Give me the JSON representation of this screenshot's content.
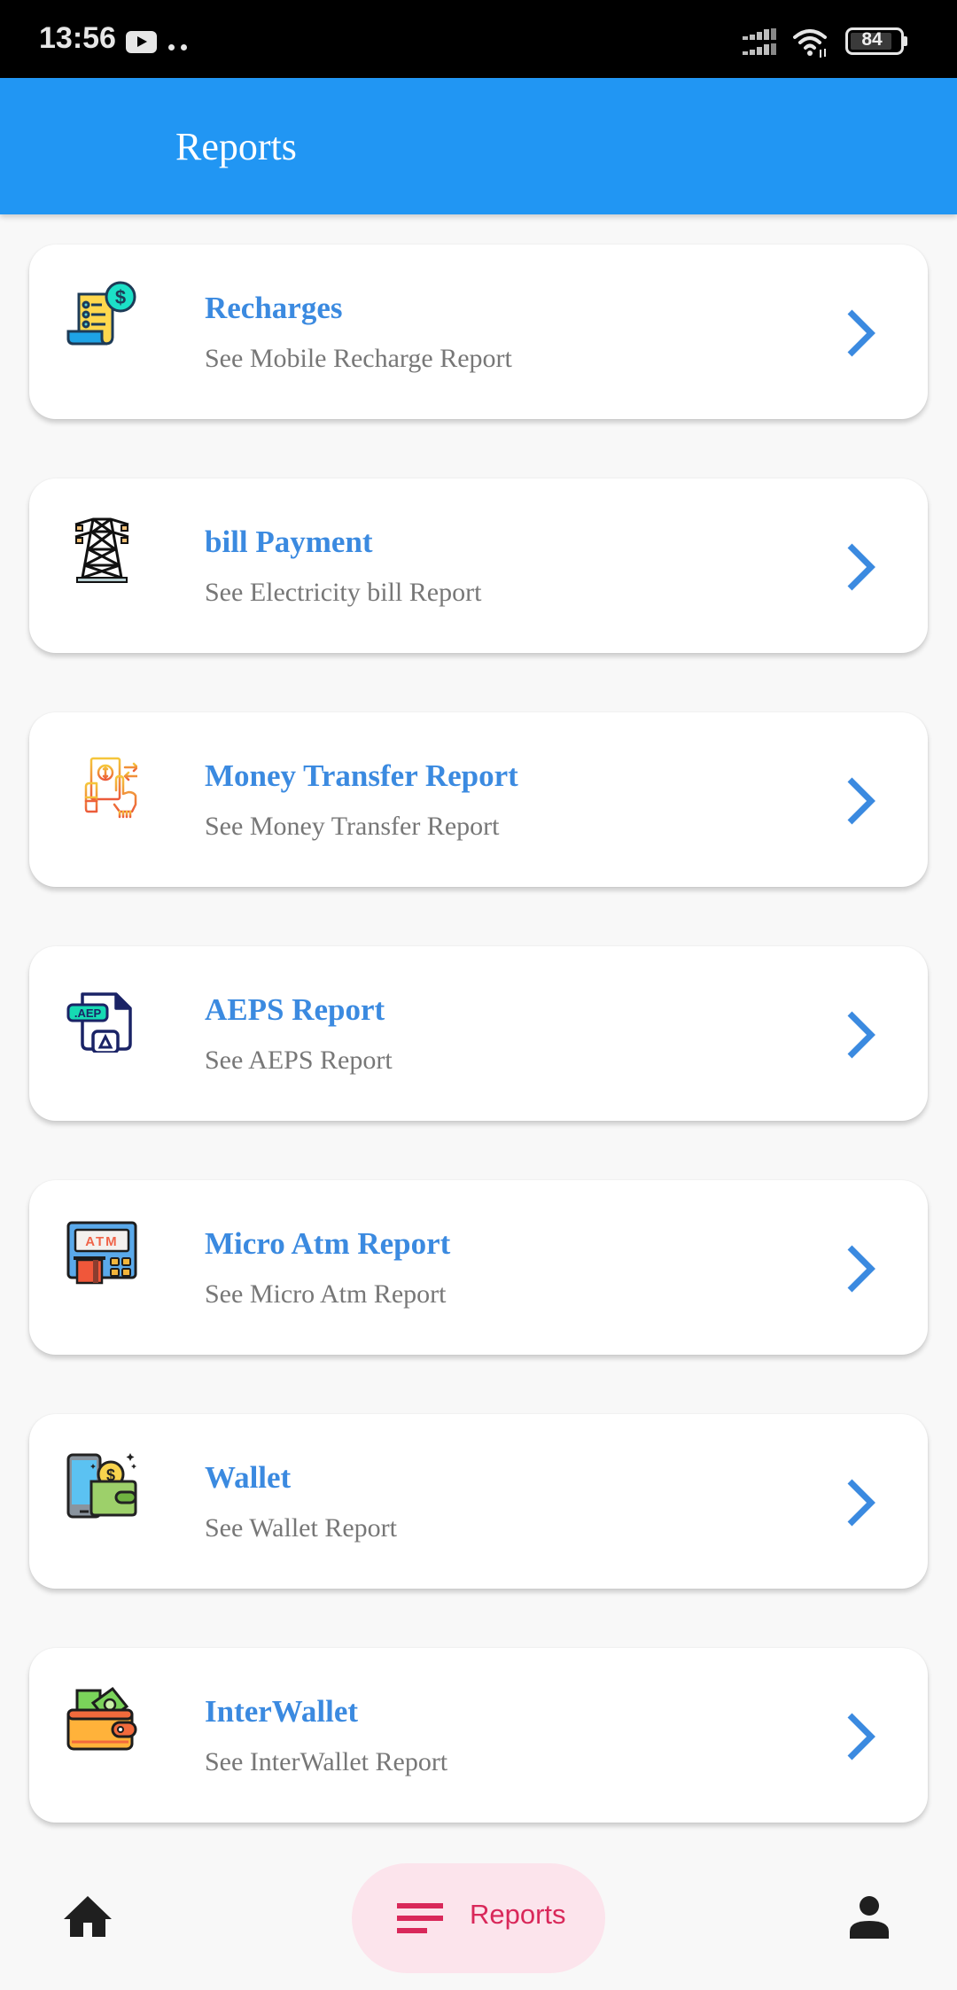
{
  "status_bar": {
    "time": "13:56",
    "notification_icons": [
      "youtube-icon",
      "more-dots-icon"
    ],
    "signal_icon": "signal-icon",
    "wifi_icon": "wifi-icon",
    "battery_level": "84"
  },
  "app_bar": {
    "title": "Reports",
    "background_color": "#2196F3"
  },
  "reports": [
    {
      "icon": "receipt-dollar-icon",
      "title": "Recharges",
      "subtitle": "See Mobile Recharge Report"
    },
    {
      "icon": "power-tower-icon",
      "title": "bill Payment",
      "subtitle": "See Electricity bill Report"
    },
    {
      "icon": "money-transfer-icon",
      "title": "Money Transfer Report",
      "subtitle": "See Money Transfer Report"
    },
    {
      "icon": "aep-file-icon",
      "icon_text": ".AEP",
      "title": "AEPS Report",
      "subtitle": "See AEPS Report"
    },
    {
      "icon": "atm-machine-icon",
      "icon_text": "ATM",
      "title": "Micro Atm Report",
      "subtitle": "See Micro Atm Report"
    },
    {
      "icon": "mobile-wallet-icon",
      "title": "Wallet",
      "subtitle": "See Wallet Report"
    },
    {
      "icon": "wallet-cash-icon",
      "title": "InterWallet",
      "subtitle": "See InterWallet Report"
    }
  ],
  "colors": {
    "title": "#3B8AE0",
    "subtitle": "#777777",
    "chevron": "#3B8AE0",
    "nav_active_bg": "#FCE4EC",
    "nav_active_fg": "#D9285A"
  },
  "bottom_nav": {
    "items": [
      {
        "icon": "home-icon",
        "label": ""
      },
      {
        "icon": "menu-lines-icon",
        "label": "Reports",
        "active": true
      },
      {
        "icon": "person-icon",
        "label": ""
      }
    ]
  }
}
